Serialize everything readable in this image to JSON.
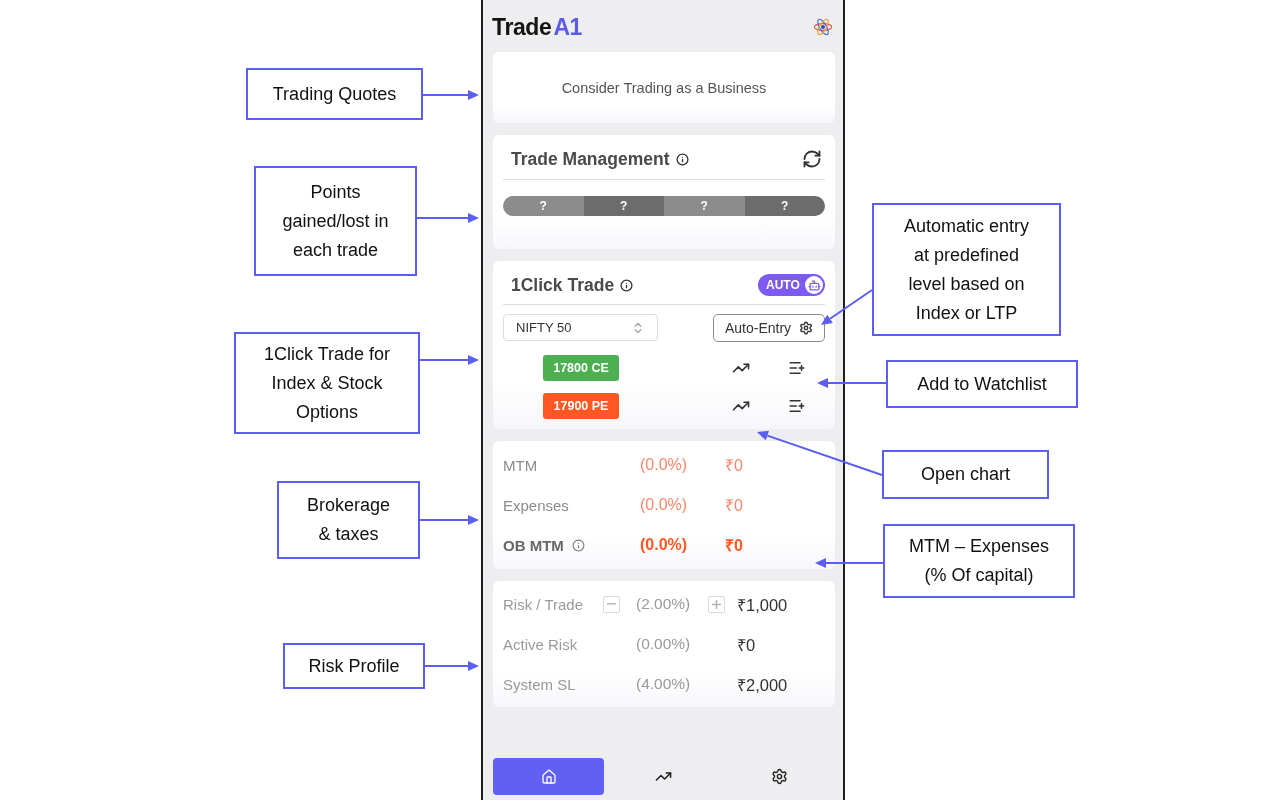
{
  "header": {
    "logo": {
      "text": "Trade",
      "accent": "A1"
    }
  },
  "quote_card": {
    "quote": "Consider Trading as a Business"
  },
  "trade_management": {
    "title": "Trade Management",
    "segments": [
      "?",
      "?",
      "?",
      "?"
    ]
  },
  "one_click": {
    "title": "1Click Trade",
    "auto_toggle": {
      "label": "AUTO",
      "on": true
    },
    "index_select": {
      "value": "NIFTY 50"
    },
    "auto_entry_button": "Auto-Entry",
    "options": [
      {
        "label": "17800 CE",
        "kind": "call"
      },
      {
        "label": "17900 PE",
        "kind": "put"
      }
    ]
  },
  "pnl": [
    {
      "label": "MTM",
      "percent": "(0.0%)",
      "amount": "₹0",
      "kind": "line"
    },
    {
      "label": "Expenses",
      "percent": "(0.0%)",
      "amount": "₹0",
      "kind": "line"
    },
    {
      "label": "OB MTM",
      "percent": "(0.0%)",
      "amount": "₹0",
      "kind": "total"
    }
  ],
  "risk": [
    {
      "label": "Risk / Trade",
      "percent": "(2.00%)",
      "amount": "₹1,000",
      "kind": "stepper"
    },
    {
      "label": "Active Risk",
      "percent": "(0.00%)",
      "amount": "₹0",
      "kind": "plain"
    },
    {
      "label": "System SL",
      "percent": "(4.00%)",
      "amount": "₹2,000",
      "kind": "plain"
    }
  ],
  "bottom_nav": [
    {
      "kind": "home",
      "selected": true
    },
    {
      "kind": "chart",
      "selected": false
    },
    {
      "kind": "settings",
      "selected": false
    }
  ],
  "callouts": {
    "left": [
      "Trading Quotes",
      "Points gained/lost in each trade",
      "1Click Trade for Index & Stock Options",
      "Brokerage & taxes",
      "Risk Profile"
    ],
    "right": [
      "Automatic entry at predefined level based on Index or LTP",
      "Add to Watchlist",
      "Open chart",
      "MTM – Expenses (% Of capital)"
    ]
  }
}
